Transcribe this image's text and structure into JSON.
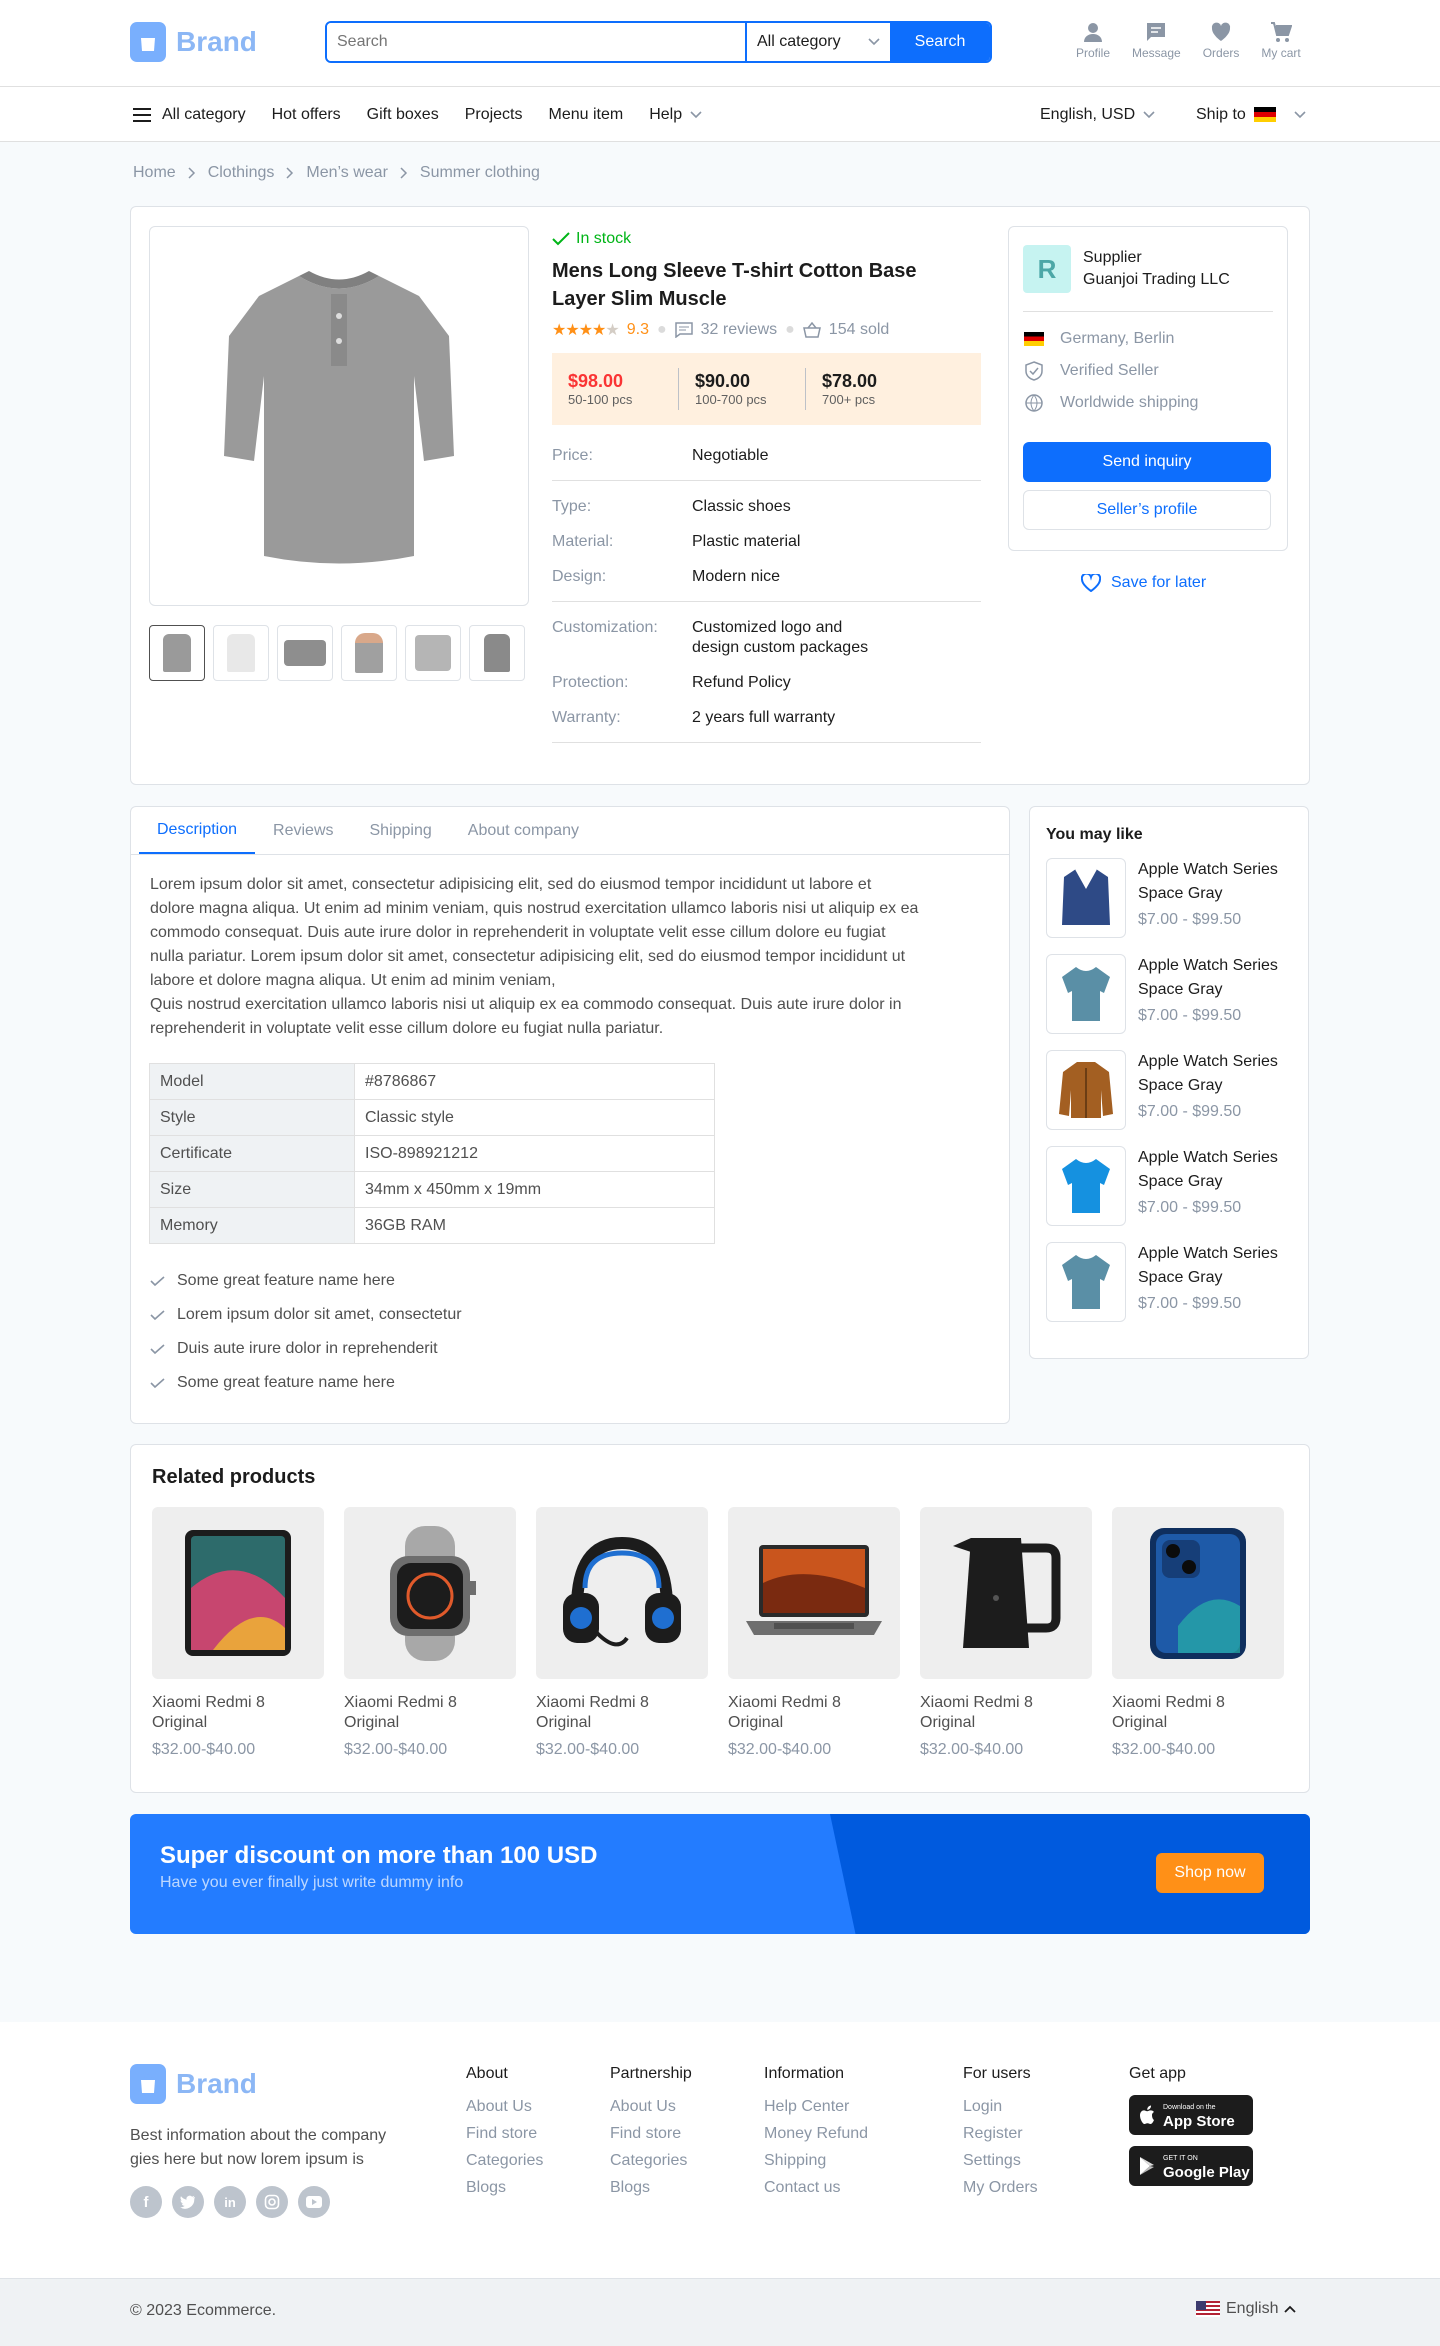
{
  "header": {
    "brand": "Brand",
    "search_placeholder": "Search",
    "category": "All category",
    "search_button": "Search",
    "icons": [
      {
        "label": "Profile",
        "icon": "user-icon"
      },
      {
        "label": "Message",
        "icon": "message-icon"
      },
      {
        "label": "Orders",
        "icon": "heart-icon"
      },
      {
        "label": "My cart",
        "icon": "cart-icon"
      }
    ]
  },
  "nav": {
    "all_category": "All category",
    "items": [
      "Hot offers",
      "Gift boxes",
      "Projects",
      "Menu item",
      "Help"
    ],
    "language": "English, USD",
    "ship_to": "Ship to"
  },
  "breadcrumb": [
    "Home",
    "Clothings",
    "Men’s wear",
    "Summer clothing"
  ],
  "product": {
    "stock": "In stock",
    "title_line1": "Mens Long Sleeve T-shirt Cotton Base",
    "title_line2": "Layer Slim Muscle",
    "rating": "9.3",
    "rating_stars": 4,
    "reviews": "32 reviews",
    "sold": "154 sold",
    "price_tiers": [
      {
        "price": "$98.00",
        "qty": "50-100 pcs"
      },
      {
        "price": "$90.00",
        "qty": "100-700 pcs"
      },
      {
        "price": "$78.00",
        "qty": "700+ pcs"
      }
    ],
    "specs": {
      "price_k": "Price:",
      "price_v": "Negotiable",
      "type_k": "Type:",
      "type_v": "Classic  shoes",
      "material_k": "Material:",
      "material_v": "Plastic material",
      "design_k": "Design:",
      "design_v": "Modern nice",
      "custom_k": "Customization:",
      "custom_v1": "Customized logo and",
      "custom_v2": "design custom packages",
      "protection_k": "Protection:",
      "protection_v": "Refund Policy",
      "warranty_k": "Warranty:",
      "warranty_v": "2 years full warranty"
    }
  },
  "supplier": {
    "initial": "R",
    "label": "Supplier",
    "name": "Guanjoi Trading LLC",
    "location": "Germany, Berlin",
    "verified": "Verified Seller",
    "shipping": "Worldwide shipping",
    "inquiry": "Send inquiry",
    "profile": "Seller’s profile",
    "save": "Save for later"
  },
  "tabs": [
    "Description",
    "Reviews",
    "Shipping",
    "About company"
  ],
  "description": [
    "Lorem ipsum dolor sit amet, consectetur adipisicing elit, sed do eiusmod tempor incididunt ut labore et",
    "dolore magna aliqua. Ut enim ad minim veniam, quis nostrud exercitation ullamco laboris nisi ut aliquip ex ea",
    "commodo consequat. Duis aute irure dolor in reprehenderit in voluptate velit esse cillum dolore eu fugiat",
    "nulla pariatur.  Lorem ipsum dolor sit amet, consectetur adipisicing elit, sed do eiusmod tempor incididunt ut",
    "labore et dolore magna aliqua. Ut enim ad minim veniam,",
    "Quis nostrud exercitation ullamco laboris nisi ut aliquip ex ea commodo consequat. Duis aute irure dolor in",
    "reprehenderit in voluptate velit esse cillum dolore eu fugiat nulla pariatur."
  ],
  "spec_table": [
    {
      "k": "Model",
      "v": "#8786867"
    },
    {
      "k": "Style",
      "v": "Classic style"
    },
    {
      "k": "Certificate",
      "v": "ISO-898921212"
    },
    {
      "k": "Size",
      "v": "34mm x 450mm x 19mm"
    },
    {
      "k": "Memory",
      "v": "36GB RAM"
    }
  ],
  "features": [
    "Some great feature name here",
    "Lorem ipsum dolor sit amet, consectetur",
    "Duis aute irure dolor in reprehenderit",
    "Some great feature name here"
  ],
  "you_may_like": {
    "title": "You may like",
    "items": [
      {
        "l1": "Apple Watch Series",
        "l2": "Space Gray",
        "price": "$7.00 - $99.50",
        "color": "#2E4A86"
      },
      {
        "l1": "Apple Watch Series",
        "l2": "Space Gray",
        "price": "$7.00 - $99.50",
        "color": "#5A8FA6"
      },
      {
        "l1": "Apple Watch Series",
        "l2": "Space Gray",
        "price": "$7.00 - $99.50",
        "color": "#A35F22"
      },
      {
        "l1": "Apple Watch Series",
        "l2": "Space Gray",
        "price": "$7.00 - $99.50",
        "color": "#1591E0"
      },
      {
        "l1": "Apple Watch Series",
        "l2": "Space Gray",
        "price": "$7.00 - $99.50",
        "color": "#5A8FA6"
      }
    ]
  },
  "related": {
    "title": "Related products",
    "items": [
      {
        "l1": "Xiaomi Redmi 8",
        "l2": "Original",
        "price": "$32.00-$40.00",
        "icon": "tablet-icon"
      },
      {
        "l1": "Xiaomi Redmi 8",
        "l2": "Original",
        "price": "$32.00-$40.00",
        "icon": "smartwatch-icon"
      },
      {
        "l1": "Xiaomi Redmi 8",
        "l2": "Original",
        "price": "$32.00-$40.00",
        "icon": "headphones-icon"
      },
      {
        "l1": "Xiaomi Redmi 8",
        "l2": "Original",
        "price": "$32.00-$40.00",
        "icon": "laptop-icon"
      },
      {
        "l1": "Xiaomi Redmi 8",
        "l2": "Original",
        "price": "$32.00-$40.00",
        "icon": "kettle-icon"
      },
      {
        "l1": "Xiaomi Redmi 8",
        "l2": "Original",
        "price": "$32.00-$40.00",
        "icon": "phone-icon"
      }
    ]
  },
  "banner": {
    "title": "Super discount on more than 100 USD",
    "subtitle": "Have you ever finally just write dummy info",
    "button": "Shop now"
  },
  "footer": {
    "brand": "Brand",
    "desc1": "Best information about the company",
    "desc2": "gies here but now lorem ipsum is",
    "columns": [
      {
        "title": "About",
        "links": [
          "About Us",
          "Find store",
          "Categories",
          "Blogs"
        ]
      },
      {
        "title": "Partnership",
        "links": [
          "About Us",
          "Find store",
          "Categories",
          "Blogs"
        ]
      },
      {
        "title": "Information",
        "links": [
          "Help Center",
          "Money Refund",
          "Shipping",
          "Contact us"
        ]
      },
      {
        "title": "For users",
        "links": [
          "Login",
          "Register",
          "Settings",
          "My Orders"
        ]
      }
    ],
    "get_app": "Get app",
    "appstore_small": "Download on the",
    "appstore": "App Store",
    "gplay_small": "GET IT ON",
    "gplay": "Google Play",
    "copyright": "© 2023 Ecommerce.",
    "language": "English"
  },
  "colors": {
    "primary": "#0D6EFD",
    "success": "#00B517",
    "danger": "#FA3434",
    "warning": "#FF9017",
    "tier_bg": "#FFF0DF"
  }
}
